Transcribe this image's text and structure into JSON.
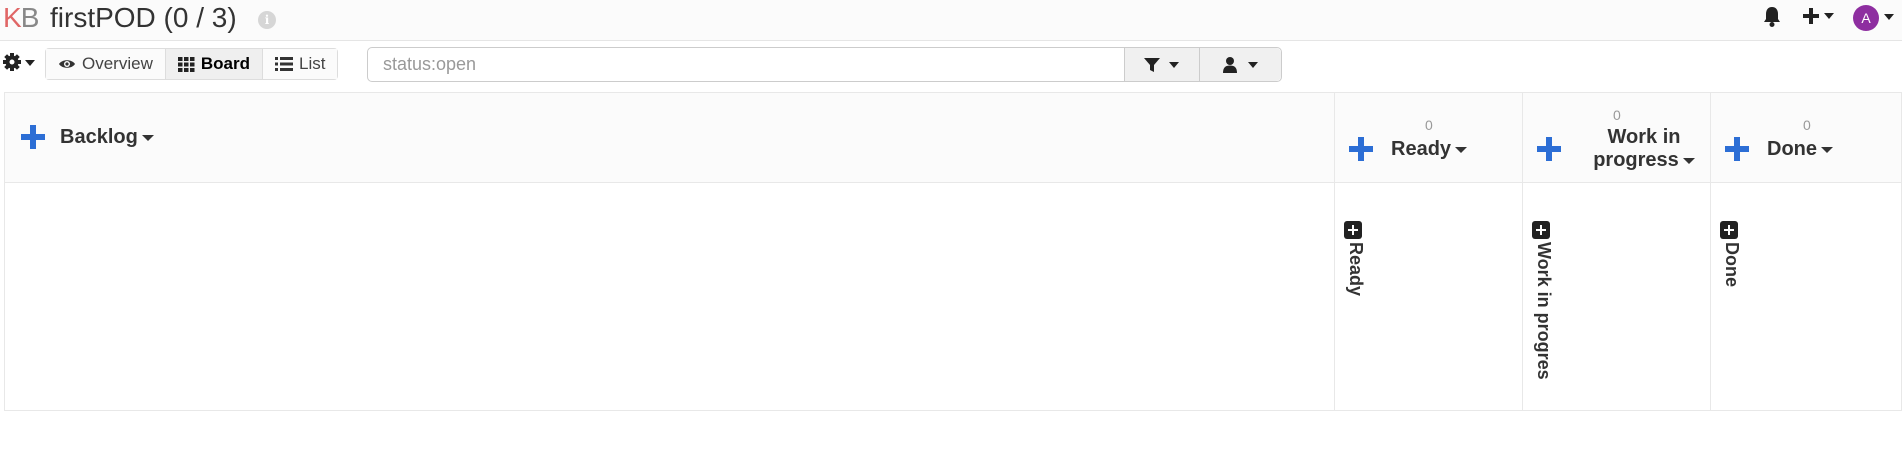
{
  "header": {
    "logo_k": "K",
    "logo_b": "B",
    "project_title": "firstPOD (0 / 3)",
    "info_icon": "i",
    "avatar_letter": "A"
  },
  "toolbar": {
    "views": [
      {
        "label": "Overview",
        "icon": "eye-icon"
      },
      {
        "label": "Board",
        "icon": "grid-icon",
        "active": true
      },
      {
        "label": "List",
        "icon": "list-icon"
      }
    ],
    "filter_placeholder": "status:open"
  },
  "board": {
    "columns": [
      {
        "title": "Backlog",
        "count": "",
        "vertical_label": ""
      },
      {
        "title": "Ready",
        "count": "0",
        "vertical_label": "Ready"
      },
      {
        "title": "Work in progress",
        "title_line1": "Work in",
        "title_line2": "progress",
        "count": "0",
        "vertical_label": "Work in progres"
      },
      {
        "title": "Done",
        "count": "0",
        "vertical_label": "Done"
      }
    ]
  },
  "colors": {
    "accent_blue": "#2c6ed5",
    "logo_k": "#e06666",
    "avatar_bg": "#8e2ea0"
  }
}
